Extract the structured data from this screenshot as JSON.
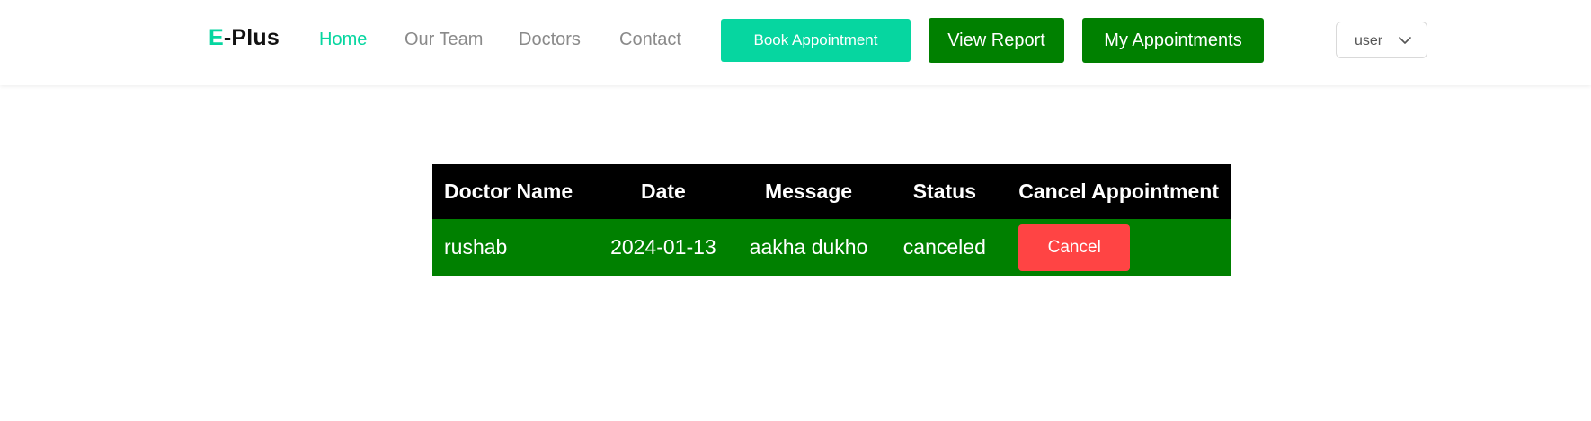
{
  "brand": {
    "prefix": "E",
    "suffix": "-Plus"
  },
  "nav": {
    "links": [
      {
        "label": "Home",
        "active": true
      },
      {
        "label": "Our Team",
        "active": false
      },
      {
        "label": "Doctors",
        "active": false
      },
      {
        "label": "Contact",
        "active": false
      }
    ],
    "buttons": {
      "book": "Book Appointment",
      "report": "View Report",
      "my_appointments": "My Appointments"
    },
    "user_dropdown": {
      "value": "user",
      "icon": "chevron-down-icon"
    }
  },
  "table": {
    "headers": [
      "Doctor Name",
      "Date",
      "Message",
      "Status",
      "Cancel Appointment"
    ],
    "rows": [
      {
        "doctor": "rushab",
        "date": "2024-01-13",
        "message": "aakha dukho",
        "status": "canceled",
        "action_label": "Cancel"
      }
    ]
  },
  "colors": {
    "accent": "#06d6a0",
    "green": "#008000",
    "header_bg": "#000000",
    "cancel": "#ff4444"
  }
}
